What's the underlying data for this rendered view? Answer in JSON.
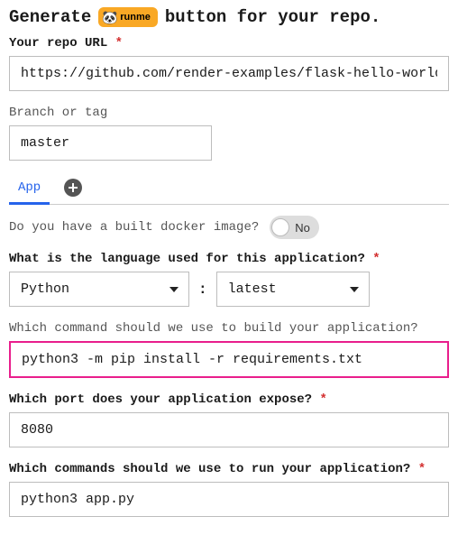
{
  "title": {
    "prefix": "Generate",
    "suffix": "button for your repo."
  },
  "badge": {
    "icon": "🐼",
    "text": "runme"
  },
  "repo": {
    "label": "Your repo URL",
    "value": "https://github.com/render-examples/flask-hello-world"
  },
  "branch": {
    "label": "Branch or tag",
    "value": "master"
  },
  "tabs": {
    "active": "App"
  },
  "docker": {
    "question": "Do you have a built docker image?",
    "state": "No"
  },
  "language": {
    "label": "What is the language used for this application?",
    "selected": "Python",
    "version": "latest",
    "separator": ":"
  },
  "build": {
    "label": "Which command should we use to build your application?",
    "value": "python3 -m pip install -r requirements.txt"
  },
  "port": {
    "label": "Which port does your application expose?",
    "value": "8080"
  },
  "run": {
    "label": "Which commands should we use to run your application?",
    "value": "python3 app.py"
  },
  "required_marker": "*"
}
